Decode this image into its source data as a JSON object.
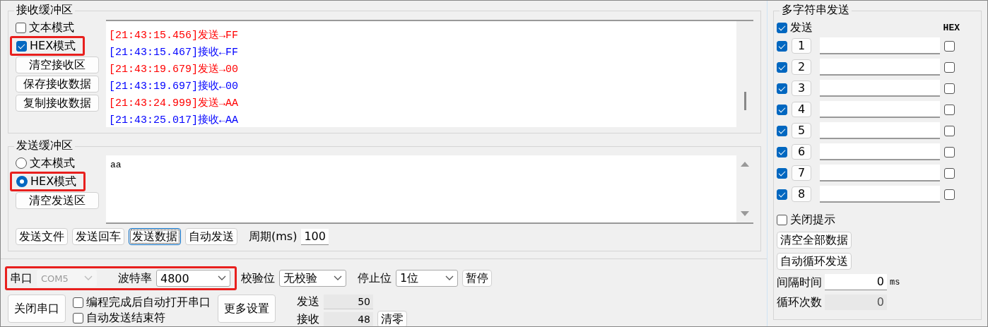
{
  "receive_buffer": {
    "title": "接收缓冲区",
    "modes": [
      {
        "label": "文本模式",
        "checked": false
      },
      {
        "label": "HEX模式",
        "checked": true
      }
    ],
    "buttons": [
      "清空接收区",
      "保存接收数据",
      "复制接收数据"
    ],
    "log": [
      {
        "text": "[21:43:15.456]发送→FF",
        "kind": "sent"
      },
      {
        "text": "[21:43:15.467]接收←FF",
        "kind": "received"
      },
      {
        "text": "[21:43:19.679]发送→00",
        "kind": "sent"
      },
      {
        "text": "[21:43:19.697]接收←00",
        "kind": "received"
      },
      {
        "text": "[21:43:24.999]发送→AA",
        "kind": "sent"
      },
      {
        "text": "[21:43:25.017]接收←AA",
        "kind": "received"
      }
    ]
  },
  "send_buffer": {
    "title": "发送缓冲区",
    "modes": [
      {
        "label": "文本模式",
        "selected": false
      },
      {
        "label": "HEX模式",
        "selected": true
      }
    ],
    "clear_button": "清空发送区",
    "value": "aa",
    "actions": [
      {
        "label": "发送文件",
        "focused": false
      },
      {
        "label": "发送回车",
        "focused": false
      },
      {
        "label": "发送数据",
        "focused": true
      },
      {
        "label": "自动发送",
        "focused": false
      }
    ],
    "period_label": "周期(ms)",
    "period_value": "100"
  },
  "serial": {
    "port": {
      "label": "串口",
      "value": "COM5",
      "disabled": true
    },
    "baud": {
      "label": "波特率",
      "value": "4800",
      "disabled": false
    },
    "parity": {
      "label": "校验位",
      "value": "无校验",
      "disabled": false
    },
    "stop_bits": {
      "label": "停止位",
      "value": "1位",
      "disabled": false
    },
    "pause_button": "暂停",
    "close_button": "关闭串口",
    "options": [
      {
        "label": "编程完成后自动打开串口",
        "checked": false
      },
      {
        "label": "自动发送结束符",
        "checked": false
      }
    ],
    "more_button": "更多设置",
    "counters": [
      {
        "label": "发送",
        "value": "50"
      },
      {
        "label": "接收",
        "value": "48"
      }
    ],
    "reset_button": "清零"
  },
  "multi_send": {
    "title": "多字符串发送",
    "send_all": {
      "label": "发送",
      "checked": true
    },
    "hex_header": "HEX",
    "rows": [
      {
        "number": "1",
        "checked": true,
        "hex": false
      },
      {
        "number": "2",
        "checked": true,
        "hex": false
      },
      {
        "number": "3",
        "checked": true,
        "hex": false
      },
      {
        "number": "4",
        "checked": true,
        "hex": false
      },
      {
        "number": "5",
        "checked": true,
        "hex": false
      },
      {
        "number": "6",
        "checked": true,
        "hex": false
      },
      {
        "number": "7",
        "checked": true,
        "hex": false
      },
      {
        "number": "8",
        "checked": true,
        "hex": false
      }
    ],
    "close_tips": {
      "label": "关闭提示",
      "checked": false
    },
    "buttons": [
      "清空全部数据",
      "自动循环发送"
    ],
    "interval": {
      "label": "间隔时间",
      "value": "0",
      "unit": "ms"
    },
    "loop_count": {
      "label": "循环次数",
      "value": "0"
    }
  }
}
